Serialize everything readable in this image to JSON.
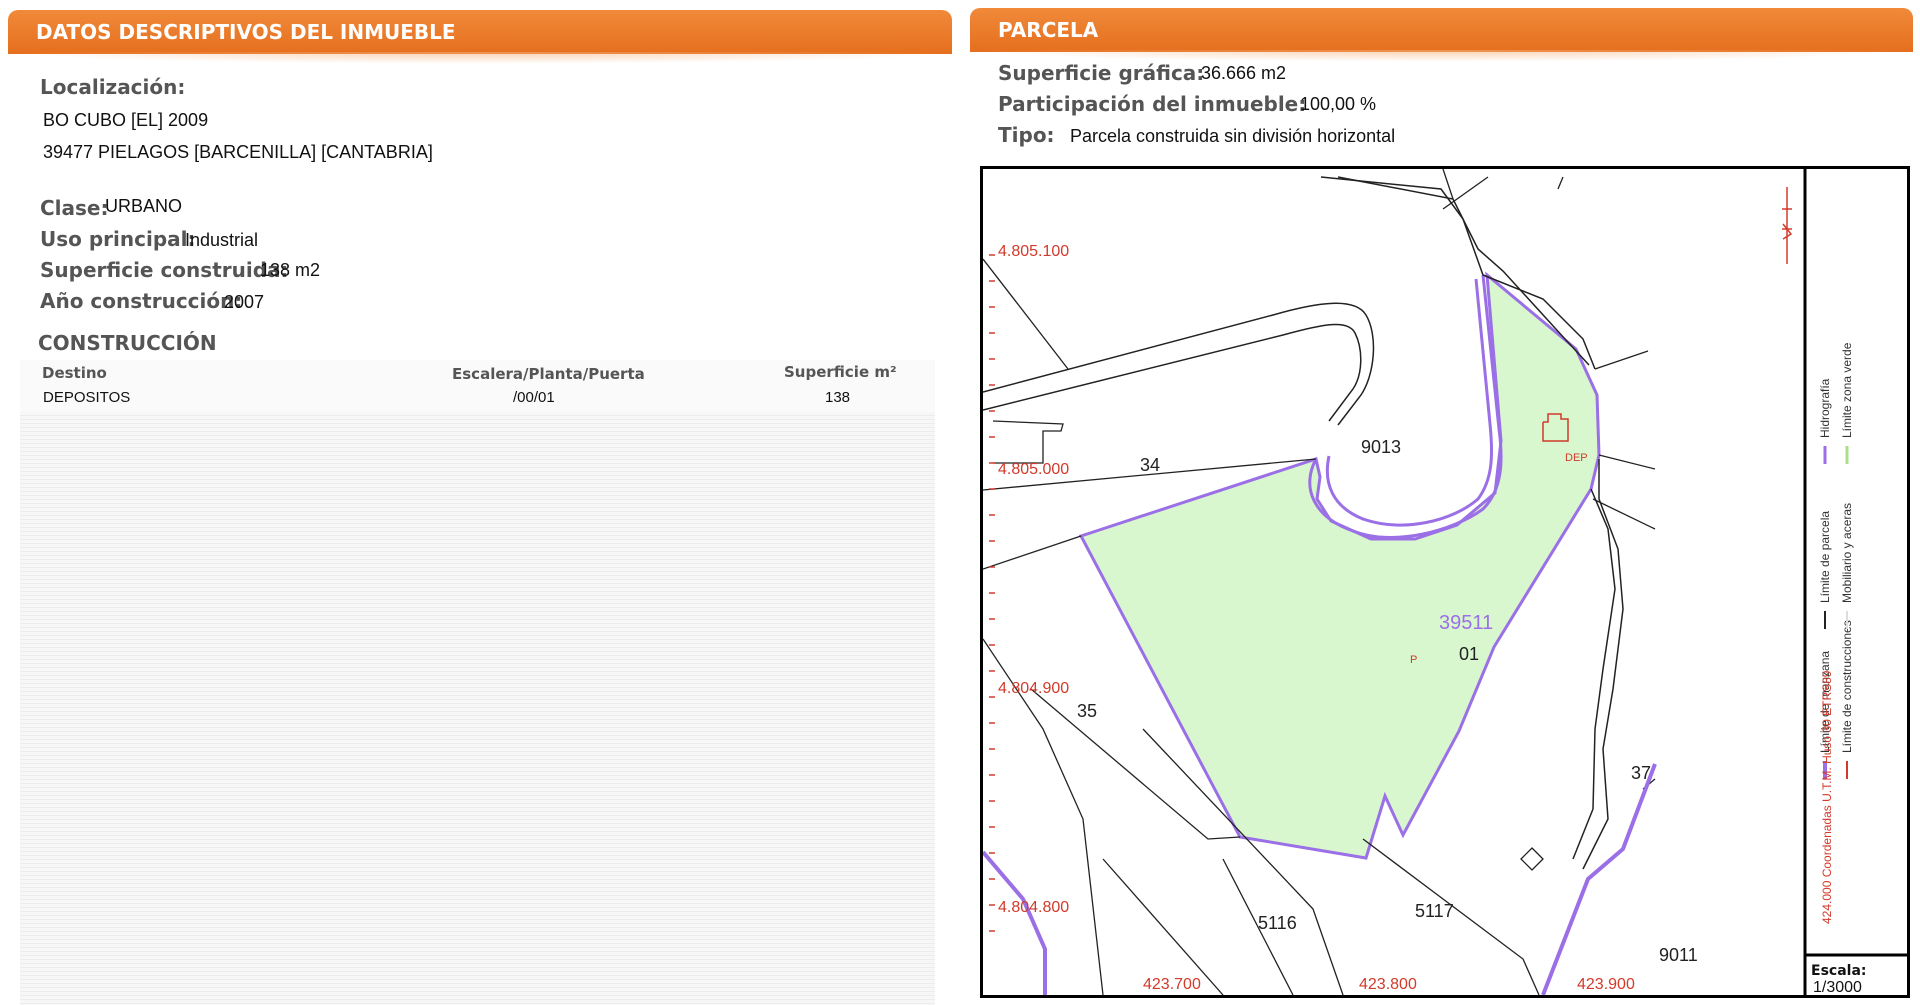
{
  "left_panel": {
    "header": "DATOS DESCRIPTIVOS DEL INMUEBLE",
    "localizacion_label": "Localización:",
    "address_line1": "BO CUBO [EL] 2009",
    "address_line2": "39477 PIELAGOS [BARCENILLA] [CANTABRIA]",
    "clase_label": "Clase:",
    "clase_value": "URBANO",
    "uso_label": "Uso principal:",
    "uso_value": "Industrial",
    "superficie_label": "Superficie construida:",
    "superficie_value": "138 m2",
    "anio_label": "Año construcción:",
    "anio_value": "2007",
    "construccion_title": "CONSTRUCCIÓN",
    "table": {
      "columns": [
        "Destino",
        "Escalera/Planta/Puerta",
        "Superficie m²"
      ],
      "rows": [
        [
          "DEPOSITOS",
          "/00/01",
          "138"
        ]
      ]
    }
  },
  "right_panel": {
    "header": "PARCELA",
    "superficie_grafica_label": "Superficie gráfica:",
    "superficie_grafica_value": "36.666 m2",
    "participacion_label": "Participación del inmueble:",
    "participacion_value": "100,00 %",
    "tipo_label": "Tipo:",
    "tipo_value": "Parcela construida sin división horizontal"
  },
  "map": {
    "y_coords": [
      "4.805.100",
      "4.805.000",
      "4.804.900",
      "4.804.800"
    ],
    "x_coords": [
      "423.700",
      "423.800",
      "423.900"
    ],
    "parcel_ref": "39511",
    "parcel_sub": "01",
    "p_marker": "P",
    "dep_label": "DEP",
    "neighbor_labels": [
      "34",
      "9013",
      "35",
      "37",
      "5116",
      "5117",
      "9011"
    ],
    "legend": [
      {
        "text": "Límite de manzana",
        "color": "#9b6fe6"
      },
      {
        "text": "Límite de parcela",
        "color": "#222222"
      },
      {
        "text": "Hidrografía",
        "color": "#9b6fe6"
      },
      {
        "text": "Límite de construcciones",
        "color": "#d23a2a"
      },
      {
        "text": "Mobiliario y aceras",
        "color": "#dddddd"
      },
      {
        "text": "Límite zona verde",
        "color": "#a8e08a"
      }
    ],
    "coord_system": "424.000 Coordenadas U.T.M. Huso 30 ETRS89",
    "escala_label": "Escala:",
    "escala_value": "1/3000",
    "parcel_fill": "#d9f7cf",
    "boundary_color": "#9b6fe6"
  }
}
